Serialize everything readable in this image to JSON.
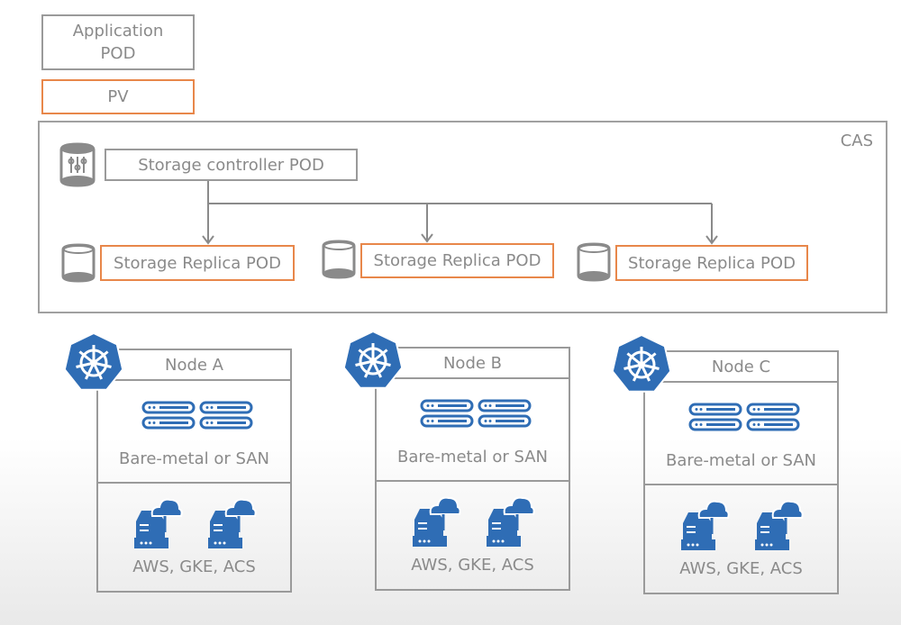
{
  "legend": {
    "app_pod": "Application POD",
    "pv": "PV"
  },
  "cas": {
    "label": "CAS",
    "controller": "Storage controller POD",
    "replicas": [
      "Storage Replica POD",
      "Storage Replica POD",
      "Storage Replica POD"
    ]
  },
  "nodes": [
    {
      "name": "Node A",
      "storage": "Bare-metal or SAN",
      "cloud": "AWS, GKE, ACS"
    },
    {
      "name": "Node B",
      "storage": "Bare-metal or SAN",
      "cloud": "AWS, GKE, ACS"
    },
    {
      "name": "Node C",
      "storage": "Bare-metal or SAN",
      "cloud": "AWS, GKE, ACS"
    }
  ],
  "colors": {
    "pv_border": "#e8874a",
    "icon_blue": "#2f6db5",
    "line": "#9a9a9a"
  },
  "icons": [
    "database-controller-icon",
    "database-icon",
    "kubernetes-icon",
    "server-rack-icon",
    "cloud-server-icon"
  ]
}
